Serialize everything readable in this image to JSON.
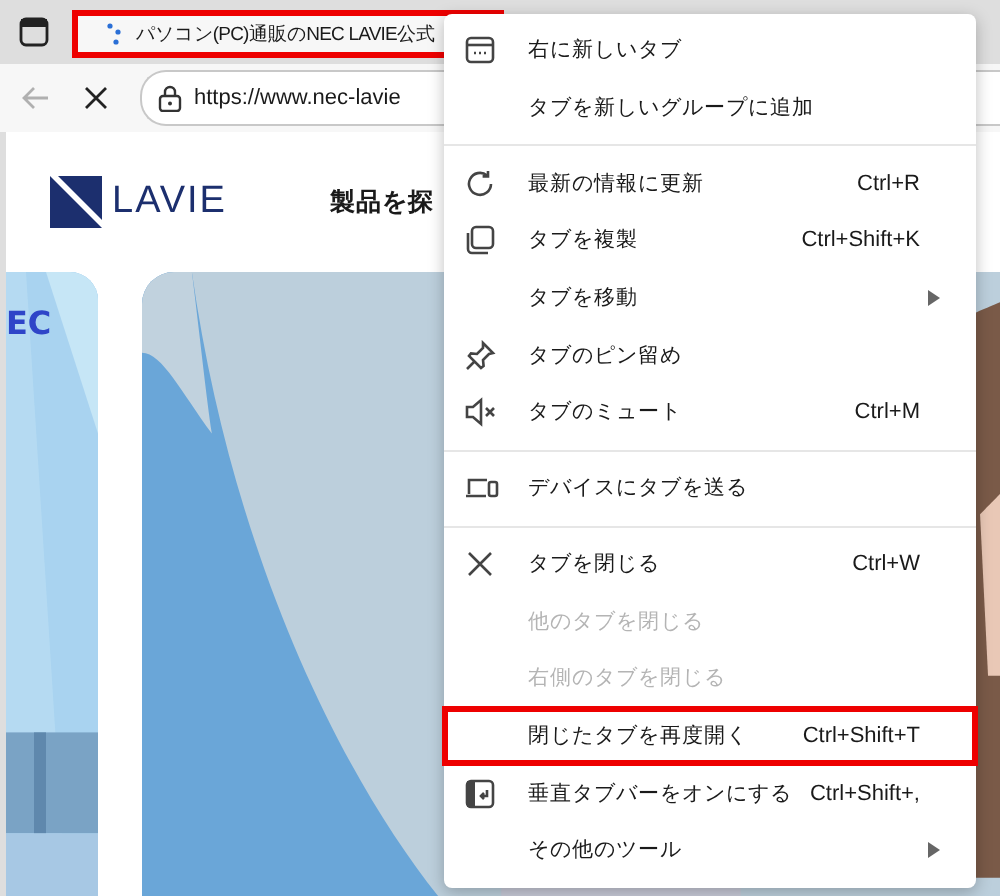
{
  "tab": {
    "title": "パソコン(PC)通販のNEC LAVIE公式",
    "highlighted": true
  },
  "address_bar": {
    "url": "https://www.nec-lavie"
  },
  "page": {
    "logo": "LAVIE",
    "nav_text": "製品を探",
    "side_logo": "EC"
  },
  "context_menu": {
    "items": [
      {
        "kind": "item",
        "label": "右に新しいタブ",
        "disabled": false,
        "highlighted": false
      },
      {
        "kind": "item",
        "label": "タブを新しいグループに追加",
        "disabled": false,
        "highlighted": false
      },
      {
        "kind": "divider"
      },
      {
        "kind": "item",
        "label": "最新の情報に更新",
        "shortcut": "Ctrl+R",
        "disabled": false,
        "highlighted": false
      },
      {
        "kind": "item",
        "label": "タブを複製",
        "shortcut": "Ctrl+Shift+K",
        "disabled": false,
        "highlighted": false
      },
      {
        "kind": "item",
        "label": "タブを移動",
        "submenu": true,
        "disabled": false,
        "highlighted": false
      },
      {
        "kind": "item",
        "label": "タブのピン留め",
        "disabled": false,
        "highlighted": false
      },
      {
        "kind": "item",
        "label": "タブのミュート",
        "shortcut": "Ctrl+M",
        "disabled": false,
        "highlighted": false
      },
      {
        "kind": "divider"
      },
      {
        "kind": "item",
        "label": "デバイスにタブを送る",
        "disabled": false,
        "highlighted": false
      },
      {
        "kind": "divider"
      },
      {
        "kind": "item",
        "label": "タブを閉じる",
        "shortcut": "Ctrl+W",
        "disabled": false,
        "highlighted": false
      },
      {
        "kind": "item",
        "label": "他のタブを閉じる",
        "disabled": true,
        "highlighted": false
      },
      {
        "kind": "item",
        "label": "右側のタブを閉じる",
        "disabled": true,
        "highlighted": false
      },
      {
        "kind": "item",
        "label": "閉じたタブを再度開く",
        "shortcut": "Ctrl+Shift+T",
        "disabled": false,
        "highlighted": true
      },
      {
        "kind": "item",
        "label": "垂直タブバーをオンにする",
        "shortcut": "Ctrl+Shift+,",
        "disabled": false,
        "highlighted": false
      },
      {
        "kind": "item",
        "label": "その他のツール",
        "submenu": true,
        "disabled": false,
        "highlighted": false
      }
    ]
  }
}
